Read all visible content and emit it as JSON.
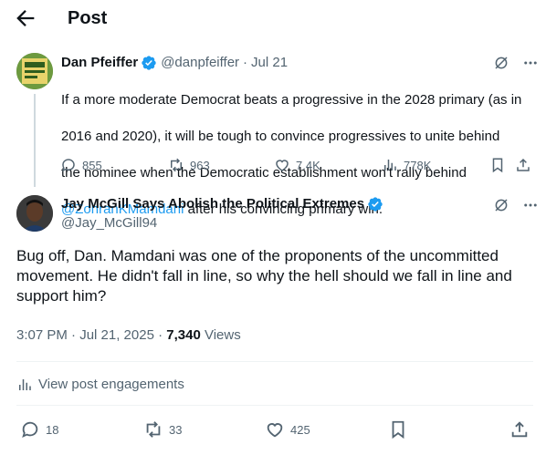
{
  "header": {
    "title": "Post"
  },
  "parent_tweet": {
    "display_name": "Dan Pfeiffer",
    "handle": "@danpfeiffer",
    "separator": "·",
    "date": "Jul 21",
    "text_lines": [
      "If a more moderate Democrat beats a progressive in the 2028 primary (as in",
      "2016 and 2020), it will be tough to convince progressives to unite behind",
      "the nominee when the Democratic establishment won't rally behind"
    ],
    "mention": "@ZohranKMamdani",
    "text_after_mention": " after his convincing primary win.",
    "stats": {
      "replies": "855",
      "reposts": "963",
      "likes": "7.4K",
      "views": "778K"
    }
  },
  "main_tweet": {
    "display_name": "Jay McGill Says Abolish the Political Extremes",
    "handle": "@Jay_McGill94",
    "text": "Bug off, Dan. Mamdani was one of the proponents of the uncommitted movement. He didn't fall in line, so why the hell should we fall in line and support him?",
    "timestamp": "3:07 PM · Jul 21, 2025 · ",
    "views_count": "7,340",
    "views_label": " Views",
    "engagements_link": "View post engagements",
    "stats": {
      "replies": "18",
      "reposts": "33",
      "likes": "425"
    }
  },
  "colors": {
    "accent": "#1d9bf0",
    "muted": "#536471",
    "text": "#0f1419",
    "divider": "#eff3f4"
  },
  "icons": [
    "back-arrow-icon",
    "verified-badge-icon",
    "grok-icon",
    "more-icon",
    "reply-icon",
    "repost-icon",
    "like-icon",
    "views-icon",
    "bookmark-icon",
    "share-icon"
  ]
}
